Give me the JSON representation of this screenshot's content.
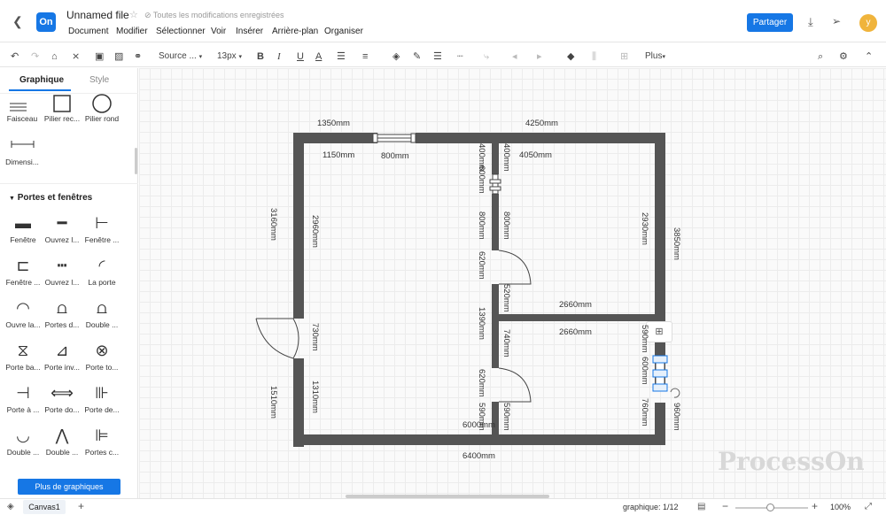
{
  "header": {
    "back_icon": "chevron-left-icon",
    "logo_text": "On",
    "file_title": "Unnamed file",
    "save_status": "Toutes les modifications enregistrées",
    "share_label": "Partager",
    "user_initial": "y",
    "menu": [
      "Document",
      "Modifier",
      "Sélectionner",
      "Voir",
      "Insérer",
      "Arrière-plan",
      "Organiser"
    ]
  },
  "toolbar": {
    "font_family": "Source ...",
    "font_size": "13px",
    "bold": "B",
    "italic": "I",
    "underline": "U",
    "text_color": "A",
    "more_label": "Plus"
  },
  "sidebar": {
    "tabs": [
      "Graphique",
      "Style"
    ],
    "top_shapes": [
      "Faisceau",
      "Pilier rec...",
      "Pilier rond"
    ],
    "dimension_shape": "Dimensi...",
    "section_title": "Portes et fenêtres",
    "shapes": [
      "Fenêtre",
      "Ouvrez l...",
      "Fenêtre ...",
      "Fenêtre ...",
      "Ouvrez l...",
      "La porte",
      "Ouvre la...",
      "Portes d...",
      "Double ...",
      "Porte ba...",
      "Porte inv...",
      "Porte to...",
      "Porte à ...",
      "Porte do...",
      "Porte de...",
      "Double ...",
      "Double ...",
      "Portes c..."
    ],
    "more_button": "Plus de graphiques"
  },
  "canvas": {
    "dims": {
      "top_left": "1350mm",
      "top_right": "4250mm",
      "inner_1150": "1150mm",
      "inner_800": "800mm",
      "inner_400a": "400mm",
      "inner_400b": "400mm",
      "inner_600": "600mm",
      "inner_4050": "4050mm",
      "left_3160": "3160mm",
      "left_2960": "2960mm",
      "left_730": "730mm",
      "left_1510": "1510mm",
      "left_1310": "1310mm",
      "mid_800a": "800mm",
      "mid_800b": "800mm",
      "mid_620a": "620mm",
      "mid_520": "520mm",
      "mid_1390": "1390mm",
      "mid_740": "740mm",
      "mid_620b": "620mm",
      "mid_590a": "590mm",
      "mid_590b": "590mm",
      "right_2930": "2930mm",
      "right_3850": "3850mm",
      "right_590": "590mm",
      "right_600": "600mm",
      "right_760": "760mm",
      "right_960": "960mm",
      "h_2660a": "2660mm",
      "h_2660b": "2660mm",
      "bottom_6000": "6000mm",
      "bottom_6400": "6400mm"
    },
    "watermark": "ProcessOn"
  },
  "status": {
    "page_tab": "Canvas1",
    "graphic_count": "graphique: 1/12",
    "zoom": "100%"
  },
  "colors": {
    "accent": "#1677e5",
    "wall": "#555555",
    "avatar": "#f0b43c"
  }
}
